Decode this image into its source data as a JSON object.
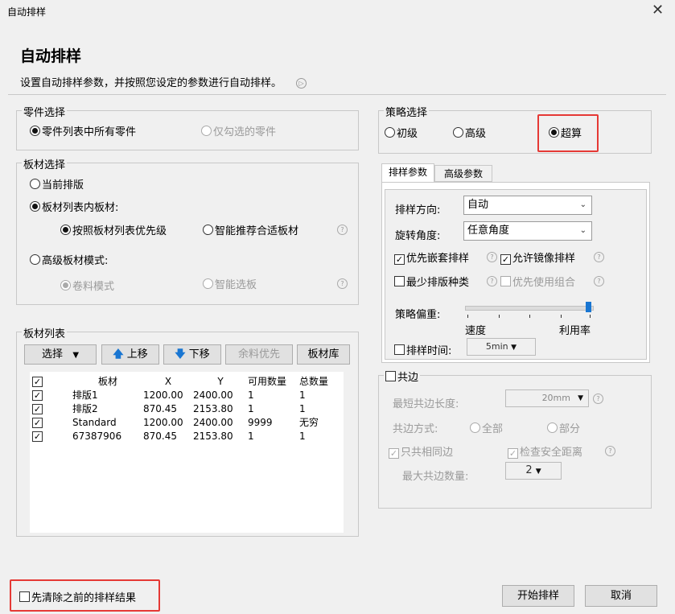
{
  "window": {
    "title": "自动排样"
  },
  "header": {
    "title": "自动排样",
    "subtitle": "设置自动排样参数，并按照您设定的参数进行自动排样。"
  },
  "part_selection": {
    "label": "零件选择",
    "option_all": "零件列表中所有零件",
    "option_checked": "仅勾选的零件"
  },
  "sheet_selection": {
    "label": "板材选择",
    "current_layout": "当前排版",
    "in_sheet_list": "板材列表内板材:",
    "by_priority": "按照板材列表优先级",
    "smart_recommend": "智能推荐合适板材",
    "advanced_mode": "高级板材模式:",
    "coil_mode": "卷料模式",
    "smart_select": "智能选板"
  },
  "sheet_list": {
    "label": "板材列表",
    "select_btn": "选择",
    "up_btn": "上移",
    "down_btn": "下移",
    "remnant_btn": "余料优先",
    "library_btn": "板材库",
    "columns": [
      "板材",
      "X",
      "Y",
      "可用数量",
      "总数量"
    ],
    "rows": [
      {
        "name": "排版1",
        "x": "1200.00",
        "y": "2400.00",
        "avail": "1",
        "total": "1"
      },
      {
        "name": "排版2",
        "x": "870.45",
        "y": "2153.80",
        "avail": "1",
        "total": "1"
      },
      {
        "name": "Standard",
        "x": "1200.00",
        "y": "2400.00",
        "avail": "9999",
        "total": "无穷"
      },
      {
        "name": "67387906",
        "x": "870.45",
        "y": "2153.80",
        "avail": "1",
        "total": "1"
      }
    ]
  },
  "strategy": {
    "label": "策略选择",
    "basic": "初级",
    "advanced": "高级",
    "super": "超算"
  },
  "tabs": {
    "nesting_params": "排样参数",
    "advanced_params": "高级参数"
  },
  "nesting_params": {
    "direction_label": "排样方向:",
    "direction_value": "自动",
    "rotation_label": "旋转角度:",
    "rotation_value": "任意角度",
    "prefer_nested": "优先嵌套排样",
    "allow_mirror": "允许镜像排样",
    "min_layout_types": "最少排版种类",
    "prefer_combination": "优先使用组合",
    "weight_label": "策略偏重:",
    "speed": "速度",
    "utilization": "利用率",
    "time_label": "排样时间:",
    "time_value": "5min"
  },
  "common_edge": {
    "label": "共边",
    "min_length_label": "最短共边长度:",
    "min_length_value": "20mm",
    "mode_label": "共边方式:",
    "all": "全部",
    "partial": "部分",
    "same_only": "只共相同边",
    "check_safety": "检查安全距离",
    "max_count_label": "最大共边数量:",
    "max_count_value": "2"
  },
  "footer": {
    "clear_previous": "先清除之前的排样结果",
    "start_btn": "开始排样",
    "cancel_btn": "取消"
  },
  "icons": {
    "close": "close-icon",
    "info": "info-icon",
    "help": "help-icon",
    "up": "arrow-up-icon",
    "down": "arrow-down-icon",
    "dropdown": "chevron-down-icon"
  },
  "colors": {
    "highlight": "#e53935",
    "arrow": "#1976d2",
    "slider_handle": "#1976d2"
  }
}
